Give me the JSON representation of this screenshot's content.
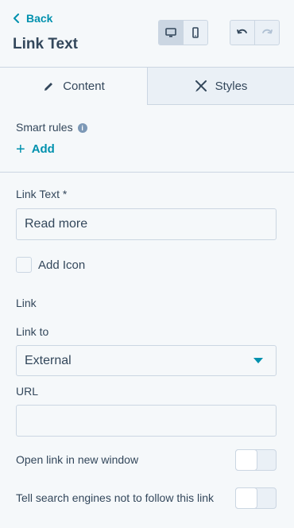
{
  "header": {
    "back_label": "Back",
    "title": "Link Text",
    "view_buttons": [
      "desktop-icon",
      "mobile-icon"
    ],
    "history_buttons": [
      "undo-icon",
      "redo-icon"
    ]
  },
  "tabs": {
    "content_label": "Content",
    "styles_label": "Styles"
  },
  "smart_rules": {
    "label": "Smart rules",
    "add_label": "Add"
  },
  "link_text": {
    "label": "Link Text *",
    "value": "Read more"
  },
  "add_icon": {
    "label": "Add Icon",
    "checked": false
  },
  "link_section": {
    "heading": "Link",
    "link_to_label": "Link to",
    "link_to_value": "External",
    "url_label": "URL",
    "url_value": ""
  },
  "toggles": {
    "new_window_label": "Open link in new window",
    "nofollow_label": "Tell search engines not to follow this link"
  },
  "colors": {
    "accent": "#0091ae",
    "text": "#33475b",
    "border": "#cbd6e2",
    "background": "#f5f8fa"
  }
}
